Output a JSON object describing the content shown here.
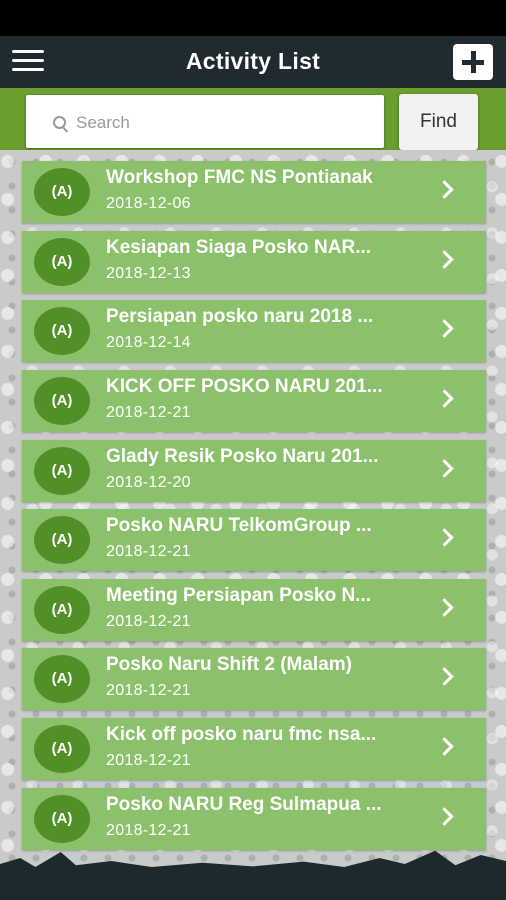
{
  "app": {
    "title": "Activity List"
  },
  "search": {
    "placeholder": "Search",
    "value": "",
    "find_label": "Find"
  },
  "items": [
    {
      "title": "Workshop FMC NS Pontianak",
      "date": "2018-12-06",
      "icon_text": "(A)"
    },
    {
      "title": "Kesiapan Siaga Posko NAR...",
      "date": "2018-12-13",
      "icon_text": "(A)"
    },
    {
      "title": "Persiapan posko naru 2018 ...",
      "date": "2018-12-14",
      "icon_text": "(A)"
    },
    {
      "title": "KICK OFF POSKO NARU 201...",
      "date": "2018-12-21",
      "icon_text": "(A)"
    },
    {
      "title": "Glady Resik Posko Naru 201...",
      "date": "2018-12-20",
      "icon_text": "(A)"
    },
    {
      "title": "Posko NARU TelkomGroup ...",
      "date": "2018-12-21",
      "icon_text": "(A)"
    },
    {
      "title": "Meeting Persiapan Posko N...",
      "date": "2018-12-21",
      "icon_text": "(A)"
    },
    {
      "title": "Posko Naru Shift 2 (Malam)",
      "date": "2018-12-21",
      "icon_text": "(A)"
    },
    {
      "title": "Kick off posko naru fmc nsa...",
      "date": "2018-12-21",
      "icon_text": "(A)"
    },
    {
      "title": "Posko NARU Reg Sulmapua ...",
      "date": "2018-12-21",
      "icon_text": "(A)"
    }
  ],
  "icons": {
    "menu": "hamburger-icon",
    "add": "plus-icon",
    "search": "search-icon",
    "item": "broadcast-icon",
    "chevron": "chevron-right-icon"
  },
  "colors": {
    "appbar": "#1f2b31",
    "accent_green": "#6a9e2f",
    "item_bg": "#8cc16b",
    "avatar_bg": "#519026"
  }
}
